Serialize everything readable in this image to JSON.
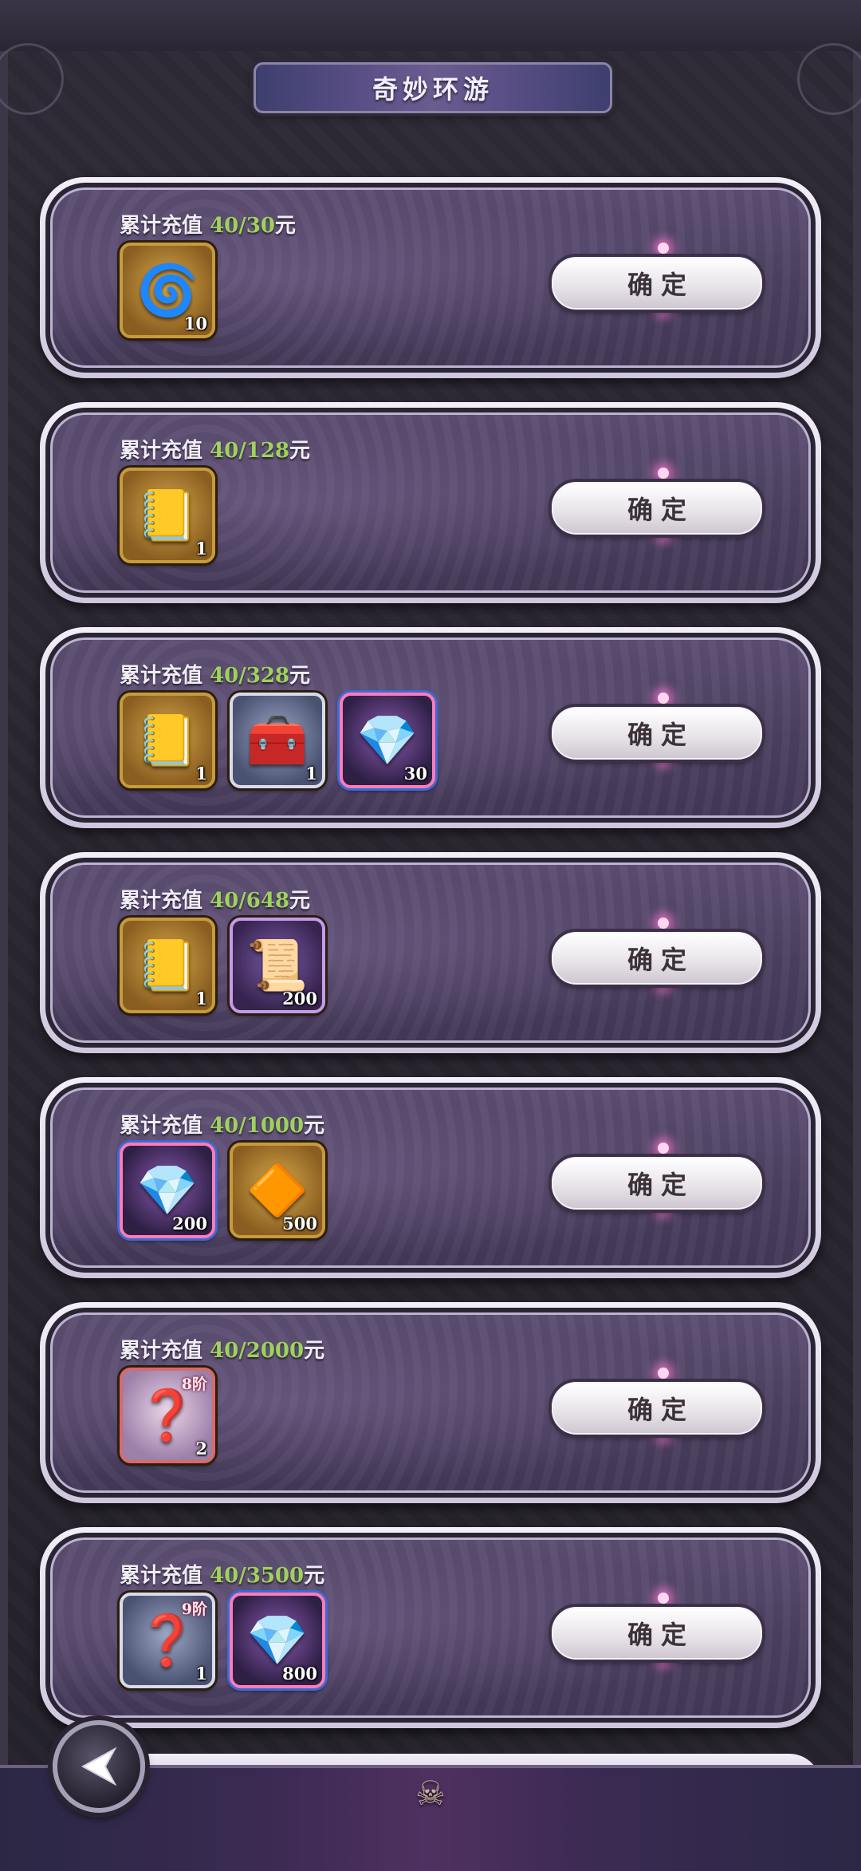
{
  "header": {
    "title": "奇妙环游"
  },
  "rewards": [
    {
      "prefix": "累计充值 ",
      "progress": "40/30",
      "unit": "元",
      "button_label": "确定",
      "items": [
        {
          "icon": "spiral-orb-icon",
          "glyph": "🌀",
          "count": "10",
          "style": "gold"
        }
      ]
    },
    {
      "prefix": "累计充值 ",
      "progress": "40/128",
      "unit": "元",
      "button_label": "确定",
      "items": [
        {
          "icon": "golden-book-icon",
          "glyph": "📒",
          "count": "1",
          "style": "gold"
        }
      ]
    },
    {
      "prefix": "累计充值 ",
      "progress": "40/328",
      "unit": "元",
      "button_label": "确定",
      "items": [
        {
          "icon": "golden-book-icon",
          "glyph": "📒",
          "count": "1",
          "style": "gold"
        },
        {
          "icon": "treasure-chest-icon",
          "glyph": "🧰",
          "count": "1",
          "style": "silver"
        },
        {
          "icon": "dark-crystal-icon",
          "glyph": "💎",
          "count": "30",
          "style": "rainbow"
        }
      ]
    },
    {
      "prefix": "累计充值 ",
      "progress": "40/648",
      "unit": "元",
      "button_label": "确定",
      "items": [
        {
          "icon": "golden-book-icon",
          "glyph": "📒",
          "count": "1",
          "style": "gold"
        },
        {
          "icon": "scroll-icon",
          "glyph": "📜",
          "count": "200",
          "style": "purple"
        }
      ]
    },
    {
      "prefix": "累计充值 ",
      "progress": "40/1000",
      "unit": "元",
      "button_label": "确定",
      "items": [
        {
          "icon": "dark-crystal-icon",
          "glyph": "💎",
          "count": "200",
          "style": "rainbow"
        },
        {
          "icon": "amber-crystal-icon",
          "glyph": "🔶",
          "count": "500",
          "style": "gold"
        }
      ]
    },
    {
      "prefix": "累计充值 ",
      "progress": "40/2000",
      "unit": "元",
      "button_label": "确定",
      "items": [
        {
          "icon": "mystery-chest-icon",
          "glyph": "❓",
          "count": "2",
          "tier": "8阶",
          "style": "red"
        }
      ]
    },
    {
      "prefix": "累计充值 ",
      "progress": "40/3500",
      "unit": "元",
      "button_label": "确定",
      "items": [
        {
          "icon": "mystery-chest-icon",
          "glyph": "❓",
          "count": "1",
          "tier": "9阶",
          "style": "silver"
        },
        {
          "icon": "dark-crystal-icon",
          "glyph": "💎",
          "count": "800",
          "style": "rainbow"
        }
      ]
    }
  ],
  "nav": {
    "back_icon": "back-arrow-icon",
    "back_glyph": "◀"
  },
  "colors": {
    "progress_text": "#9fd15e",
    "card_frame": "#f3eef8",
    "card_body": "#4c4060",
    "button": "#e9e4ea"
  }
}
